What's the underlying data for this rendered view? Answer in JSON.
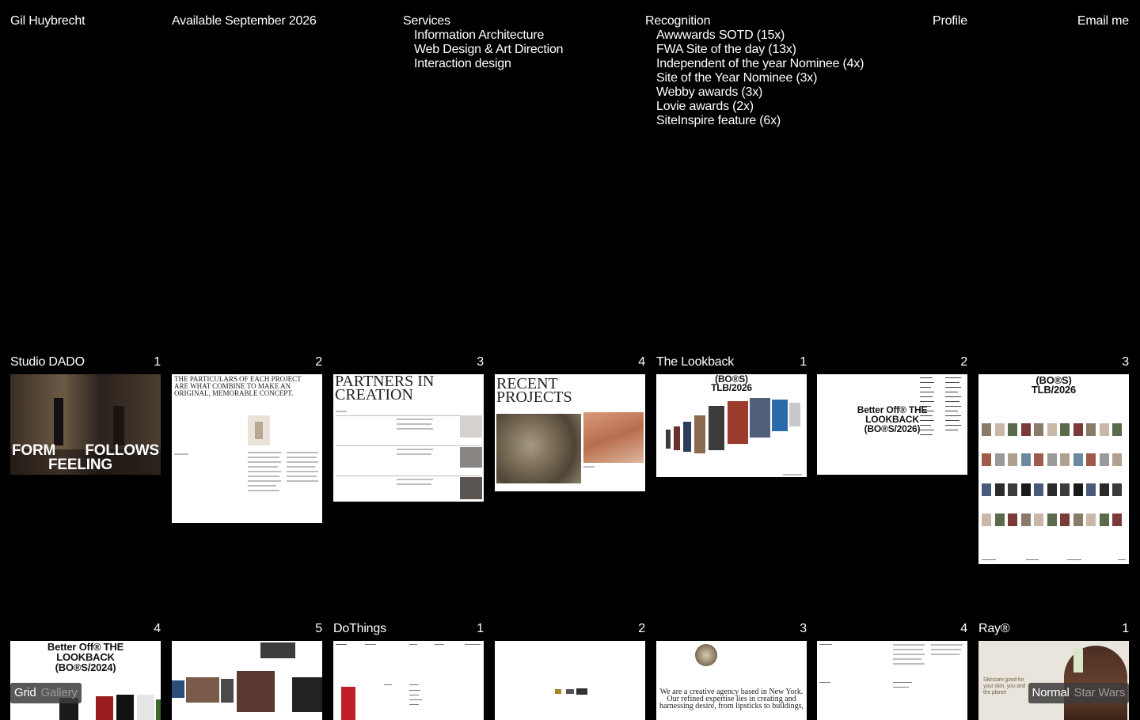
{
  "header": {
    "brand": "Gil Huybrecht",
    "availability": "Available September 2026",
    "services": {
      "title": "Services",
      "items": [
        "Information Architecture",
        "Web Design & Art Direction",
        "Interaction design"
      ]
    },
    "recognition": {
      "title": "Recognition",
      "items": [
        "Awwwards SOTD (15x)",
        "FWA Site of the day (13x)",
        "Independent of the year Nominee (4x)",
        "Site of the Year Nominee (3x)",
        "Webby awards (3x)",
        "Lovie awards (2x)",
        "SiteInspire feature (6x)"
      ]
    },
    "profile": "Profile",
    "email": "Email me"
  },
  "grid_row1": [
    {
      "project": "Studio DADO",
      "num": "1",
      "thumb": {
        "line1": "FORM",
        "line1b": "FOLLOWS",
        "line2": "FEELING"
      }
    },
    {
      "project": "",
      "num": "2",
      "thumb": {
        "text": "THE PARTICULARS OF EACH PROJECT ARE WHAT COMBINE TO MAKE AN ORIGINAL, MEMORABLE CONCEPT."
      }
    },
    {
      "project": "",
      "num": "3",
      "thumb": {
        "text": "PARTNERS IN CREATION"
      }
    },
    {
      "project": "",
      "num": "4",
      "thumb": {
        "text": "RECENT PROJECTS"
      }
    },
    {
      "project": "The Lookback",
      "num": "1",
      "thumb": {
        "text": "(BO®S) TLB/2026"
      }
    },
    {
      "project": "",
      "num": "2",
      "thumb": {
        "text": "Better Off® THE LOOKBACK (BO®S/2026)"
      }
    },
    {
      "project": "",
      "num": "3",
      "thumb": {
        "text": "(BO®S) TLB/2026"
      }
    }
  ],
  "grid_row2": [
    {
      "project": "",
      "num": "4",
      "thumb": {
        "text": "Better Off® THE LOOKBACK (BO®S/2024)"
      }
    },
    {
      "project": "",
      "num": "5",
      "thumb": {
        "text": ""
      }
    },
    {
      "project": "DoThings",
      "num": "1",
      "thumb": {
        "text": ""
      }
    },
    {
      "project": "",
      "num": "2",
      "thumb": {
        "text": ""
      }
    },
    {
      "project": "",
      "num": "3",
      "thumb": {
        "text": "We are a creative agency based in New York. Our refined expertise lies in creating and harnessing desire, from lipsticks to buildings,"
      }
    },
    {
      "project": "",
      "num": "4",
      "thumb": {
        "text": ""
      }
    },
    {
      "project": "Ray®",
      "num": "1",
      "thumb": {
        "text": "Skincare good for your skin, you and the planet"
      }
    }
  ],
  "toggles": {
    "layout": {
      "active": "Grid",
      "inactive": "Gallery"
    },
    "mode": {
      "active": "Normal",
      "inactive": "Star Wars"
    }
  }
}
